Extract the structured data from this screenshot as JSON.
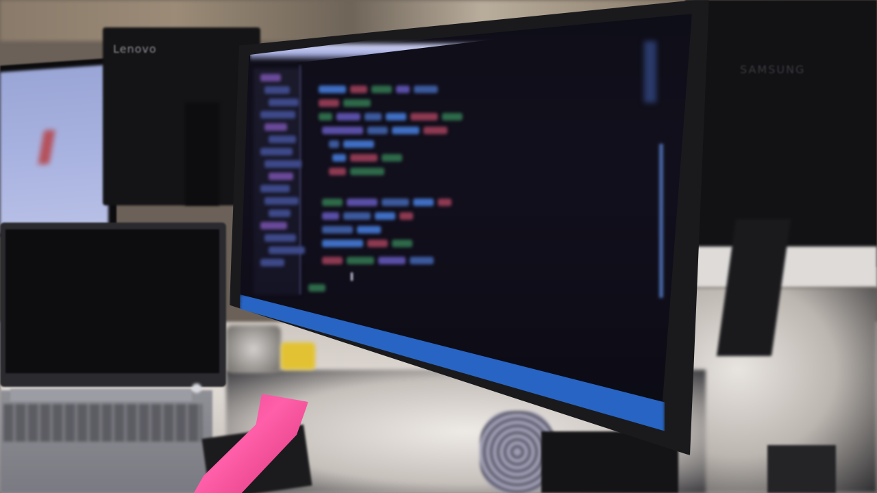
{
  "scene": {
    "brands": {
      "left_monitor": "Lenovo",
      "right_monitor": "SAMSUNG"
    },
    "colors": {
      "editor_background": "#0e0e18",
      "statusbar_blue": "#2b6ed6",
      "titlebar_highlight": "#c8ccee",
      "lanyard_pink": "#ff5fa8",
      "keyword_blue": "#3f6fc4",
      "string_red": "#8e3a52",
      "comment_green": "#2e6a4a"
    }
  }
}
